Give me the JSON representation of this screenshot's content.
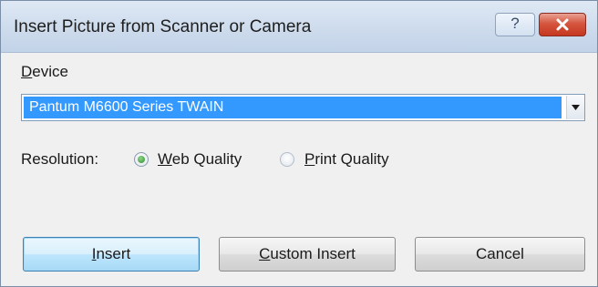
{
  "window": {
    "title": "Insert Picture from Scanner or Camera",
    "help_glyph": "?"
  },
  "device": {
    "label_accel": "D",
    "label_rest": "evice",
    "selected": "Pantum M6600 Series TWAIN"
  },
  "resolution": {
    "label": "Resolution:",
    "options": [
      {
        "accel": "W",
        "rest": "eb Quality",
        "selected": true
      },
      {
        "accel": "P",
        "rest": "rint Quality",
        "selected": false
      }
    ]
  },
  "buttons": {
    "insert": {
      "accel": "I",
      "rest": "nsert"
    },
    "custom_insert": {
      "accel": "C",
      "rest": "ustom Insert"
    },
    "cancel": "Cancel"
  },
  "colors": {
    "selection": "#3399ff",
    "close_button": "#c5381f",
    "radio_checked": "#2f8f2a"
  }
}
